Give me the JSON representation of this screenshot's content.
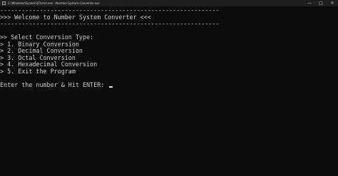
{
  "window": {
    "title": "C:\\Windows\\System32\\cmd.exe - Number-System-Converter.exe",
    "controls": {
      "minimize": "—",
      "maximize": "□",
      "close": "✕"
    }
  },
  "console": {
    "separator_top": "-------------------------------------------------------------",
    "welcome": ">>> Welcome to Number System Converter <<<",
    "separator_bottom": "-------------------------------------------------------------",
    "menu_header": ">> Select Conversion Type:",
    "options": [
      "> 1. Binary Conversion",
      "> 2. Decimal Conversion",
      "> 3. Octal Conversion",
      "> 4. Hexadecimal Conversion",
      "> 5. Exit the Program"
    ],
    "prompt": "Enter the number & Hit ENTER: "
  }
}
